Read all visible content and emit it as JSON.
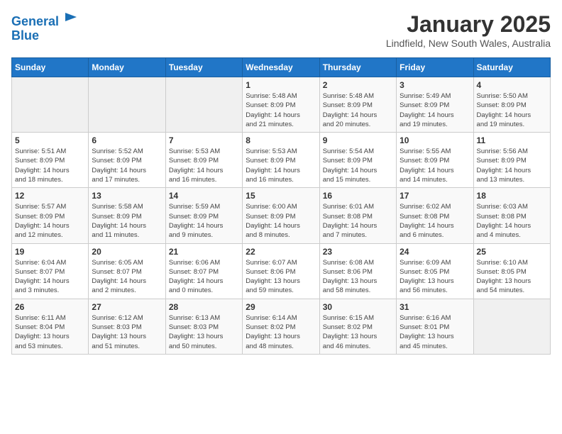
{
  "logo": {
    "line1": "General",
    "line2": "Blue"
  },
  "title": "January 2025",
  "location": "Lindfield, New South Wales, Australia",
  "days_of_week": [
    "Sunday",
    "Monday",
    "Tuesday",
    "Wednesday",
    "Thursday",
    "Friday",
    "Saturday"
  ],
  "weeks": [
    [
      {
        "day": "",
        "info": ""
      },
      {
        "day": "",
        "info": ""
      },
      {
        "day": "",
        "info": ""
      },
      {
        "day": "1",
        "info": "Sunrise: 5:48 AM\nSunset: 8:09 PM\nDaylight: 14 hours\nand 21 minutes."
      },
      {
        "day": "2",
        "info": "Sunrise: 5:48 AM\nSunset: 8:09 PM\nDaylight: 14 hours\nand 20 minutes."
      },
      {
        "day": "3",
        "info": "Sunrise: 5:49 AM\nSunset: 8:09 PM\nDaylight: 14 hours\nand 19 minutes."
      },
      {
        "day": "4",
        "info": "Sunrise: 5:50 AM\nSunset: 8:09 PM\nDaylight: 14 hours\nand 19 minutes."
      }
    ],
    [
      {
        "day": "5",
        "info": "Sunrise: 5:51 AM\nSunset: 8:09 PM\nDaylight: 14 hours\nand 18 minutes."
      },
      {
        "day": "6",
        "info": "Sunrise: 5:52 AM\nSunset: 8:09 PM\nDaylight: 14 hours\nand 17 minutes."
      },
      {
        "day": "7",
        "info": "Sunrise: 5:53 AM\nSunset: 8:09 PM\nDaylight: 14 hours\nand 16 minutes."
      },
      {
        "day": "8",
        "info": "Sunrise: 5:53 AM\nSunset: 8:09 PM\nDaylight: 14 hours\nand 16 minutes."
      },
      {
        "day": "9",
        "info": "Sunrise: 5:54 AM\nSunset: 8:09 PM\nDaylight: 14 hours\nand 15 minutes."
      },
      {
        "day": "10",
        "info": "Sunrise: 5:55 AM\nSunset: 8:09 PM\nDaylight: 14 hours\nand 14 minutes."
      },
      {
        "day": "11",
        "info": "Sunrise: 5:56 AM\nSunset: 8:09 PM\nDaylight: 14 hours\nand 13 minutes."
      }
    ],
    [
      {
        "day": "12",
        "info": "Sunrise: 5:57 AM\nSunset: 8:09 PM\nDaylight: 14 hours\nand 12 minutes."
      },
      {
        "day": "13",
        "info": "Sunrise: 5:58 AM\nSunset: 8:09 PM\nDaylight: 14 hours\nand 11 minutes."
      },
      {
        "day": "14",
        "info": "Sunrise: 5:59 AM\nSunset: 8:09 PM\nDaylight: 14 hours\nand 9 minutes."
      },
      {
        "day": "15",
        "info": "Sunrise: 6:00 AM\nSunset: 8:09 PM\nDaylight: 14 hours\nand 8 minutes."
      },
      {
        "day": "16",
        "info": "Sunrise: 6:01 AM\nSunset: 8:08 PM\nDaylight: 14 hours\nand 7 minutes."
      },
      {
        "day": "17",
        "info": "Sunrise: 6:02 AM\nSunset: 8:08 PM\nDaylight: 14 hours\nand 6 minutes."
      },
      {
        "day": "18",
        "info": "Sunrise: 6:03 AM\nSunset: 8:08 PM\nDaylight: 14 hours\nand 4 minutes."
      }
    ],
    [
      {
        "day": "19",
        "info": "Sunrise: 6:04 AM\nSunset: 8:07 PM\nDaylight: 14 hours\nand 3 minutes."
      },
      {
        "day": "20",
        "info": "Sunrise: 6:05 AM\nSunset: 8:07 PM\nDaylight: 14 hours\nand 2 minutes."
      },
      {
        "day": "21",
        "info": "Sunrise: 6:06 AM\nSunset: 8:07 PM\nDaylight: 14 hours\nand 0 minutes."
      },
      {
        "day": "22",
        "info": "Sunrise: 6:07 AM\nSunset: 8:06 PM\nDaylight: 13 hours\nand 59 minutes."
      },
      {
        "day": "23",
        "info": "Sunrise: 6:08 AM\nSunset: 8:06 PM\nDaylight: 13 hours\nand 58 minutes."
      },
      {
        "day": "24",
        "info": "Sunrise: 6:09 AM\nSunset: 8:05 PM\nDaylight: 13 hours\nand 56 minutes."
      },
      {
        "day": "25",
        "info": "Sunrise: 6:10 AM\nSunset: 8:05 PM\nDaylight: 13 hours\nand 54 minutes."
      }
    ],
    [
      {
        "day": "26",
        "info": "Sunrise: 6:11 AM\nSunset: 8:04 PM\nDaylight: 13 hours\nand 53 minutes."
      },
      {
        "day": "27",
        "info": "Sunrise: 6:12 AM\nSunset: 8:03 PM\nDaylight: 13 hours\nand 51 minutes."
      },
      {
        "day": "28",
        "info": "Sunrise: 6:13 AM\nSunset: 8:03 PM\nDaylight: 13 hours\nand 50 minutes."
      },
      {
        "day": "29",
        "info": "Sunrise: 6:14 AM\nSunset: 8:02 PM\nDaylight: 13 hours\nand 48 minutes."
      },
      {
        "day": "30",
        "info": "Sunrise: 6:15 AM\nSunset: 8:02 PM\nDaylight: 13 hours\nand 46 minutes."
      },
      {
        "day": "31",
        "info": "Sunrise: 6:16 AM\nSunset: 8:01 PM\nDaylight: 13 hours\nand 45 minutes."
      },
      {
        "day": "",
        "info": ""
      }
    ]
  ]
}
